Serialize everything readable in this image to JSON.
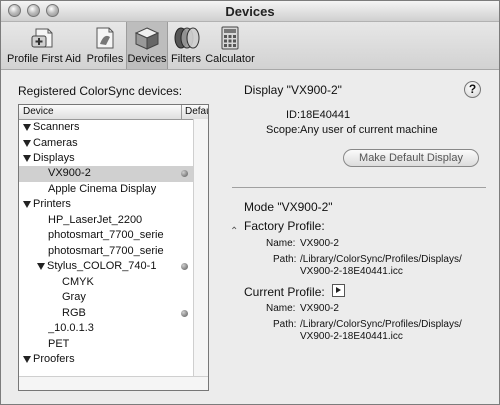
{
  "window": {
    "title": "Devices"
  },
  "toolbar": {
    "items": [
      {
        "label": "Profile First Aid",
        "icon": "first-aid-icon"
      },
      {
        "label": "Profiles",
        "icon": "profiles-icon"
      },
      {
        "label": "Devices",
        "icon": "devices-icon",
        "selected": true
      },
      {
        "label": "Filters",
        "icon": "filters-icon"
      },
      {
        "label": "Calculator",
        "icon": "calculator-icon"
      }
    ]
  },
  "devices": {
    "heading": "Registered ColorSync devices:",
    "columns": {
      "device": "Device",
      "default": "Default"
    },
    "rows": [
      {
        "label": "Scanners",
        "disclosure": "expanded"
      },
      {
        "label": "Cameras",
        "disclosure": "expanded"
      },
      {
        "label": "Displays",
        "disclosure": "expanded"
      },
      {
        "label": "VX900-2",
        "default": true,
        "selected": true
      },
      {
        "label": "Apple Cinema Display"
      },
      {
        "label": "Printers",
        "disclosure": "expanded"
      },
      {
        "label": "HP_LaserJet_2200"
      },
      {
        "label": "photosmart_7700_serie"
      },
      {
        "label": "photosmart_7700_serie"
      },
      {
        "label": "Stylus_COLOR_740-1",
        "disclosure": "expanded",
        "default": true
      },
      {
        "label": "CMYK"
      },
      {
        "label": "Gray"
      },
      {
        "label": "RGB",
        "default": true
      },
      {
        "label": "_10.0.1.3"
      },
      {
        "label": "PET"
      },
      {
        "label": "Proofers",
        "disclosure": "expanded"
      }
    ]
  },
  "detail": {
    "display_heading": "Display \"VX900-2\"",
    "help_label": "?",
    "id_label": "ID:",
    "id_value": "18E40441",
    "scope_label": "Scope:",
    "scope_value": "Any user of current machine",
    "make_default_label": "Make Default Display",
    "mode_heading": "Mode \"VX900-2\"",
    "factory_heading": "Factory Profile:",
    "factory_name_label": "Name:",
    "factory_name_value": "VX900-2",
    "factory_path_label": "Path:",
    "factory_path_line1": "/Library/ColorSync/Profiles/Displays/",
    "factory_path_line2": "VX900-2-18E40441.icc",
    "current_heading": "Current Profile:",
    "current_name_label": "Name:",
    "current_name_value": "VX900-2",
    "current_path_label": "Path:",
    "current_path_line1": "/Library/ColorSync/Profiles/Displays/",
    "current_path_line2": "VX900-2-18E40441.icc"
  }
}
